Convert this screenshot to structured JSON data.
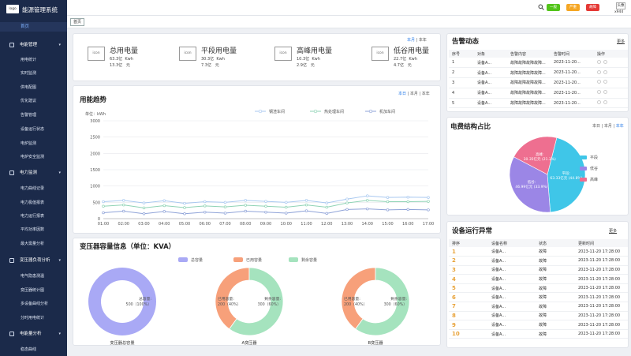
{
  "app": {
    "logo": "logo",
    "name": "能源管理系统"
  },
  "sidebar": {
    "home": "首页",
    "groups": [
      {
        "label": "电能管理",
        "items": [
          "用电统计",
          "实时监测",
          "供电配图",
          "优化建议",
          "告警管理",
          "设备运行状态",
          "电炉监测",
          "电炉安全监测"
        ]
      },
      {
        "label": "电力监测",
        "items": [
          "电力曲线记录",
          "电力极值报表",
          "电力运行报表",
          "平均功率因数",
          "最大需量分析"
        ]
      },
      {
        "label": "变压器负荷分析",
        "items": [
          "电气隐患测温",
          "变压器统计图",
          "多设备曲线分析",
          "分时用电统计"
        ]
      },
      {
        "label": "电能量分析",
        "items": [
          "稳态曲线"
        ]
      }
    ]
  },
  "topbar": {
    "buttons": [
      {
        "label": "一般",
        "color": "#52c41a"
      },
      {
        "label": "严重",
        "color": "#f5a623"
      },
      {
        "label": "故障",
        "color": "#e53935"
      }
    ],
    "avatar": "头像",
    "user": "x944"
  },
  "tabs": [
    "首页"
  ],
  "summary": {
    "period": {
      "a": "本月",
      "b": "本年"
    },
    "stats": [
      {
        "icon": "icon",
        "name": "总用电量",
        "v1": "63.3亿",
        "u1": "Kwh",
        "v2": "13.3亿",
        "u2": "元"
      },
      {
        "icon": "icon",
        "name": "平段用电量",
        "v1": "30.3亿",
        "u1": "Kwh",
        "v2": "7.3亿",
        "u2": "元"
      },
      {
        "icon": "icon",
        "name": "高峰用电量",
        "v1": "10.3亿",
        "u1": "Kwh",
        "v2": "2.9亿",
        "u2": "元"
      },
      {
        "icon": "icon",
        "name": "低谷用电量",
        "v1": "22.7亿",
        "u1": "Kwh",
        "v2": "4.7亿",
        "u2": "元"
      }
    ]
  },
  "trend": {
    "title": "用能趋势",
    "period": {
      "a": "本日",
      "b": "本月",
      "c": "本年"
    },
    "unit": "单位：kWh"
  },
  "alarms": {
    "title": "告警动态",
    "more": "更多",
    "columns": [
      "序号",
      "对象",
      "告警内容",
      "告警时间",
      "操作"
    ],
    "rows": [
      {
        "no": "1",
        "obj": "设备A...",
        "content": "故障故障故障故障...",
        "time": "2023-11-20..."
      },
      {
        "no": "2",
        "obj": "设备A...",
        "content": "故障故障故障故障...",
        "time": "2023-11-20..."
      },
      {
        "no": "3",
        "obj": "设备A...",
        "content": "故障故障故障故障...",
        "time": "2023-11-20..."
      },
      {
        "no": "4",
        "obj": "设备A...",
        "content": "故障故障故障故障...",
        "time": "2023-11-20..."
      },
      {
        "no": "5",
        "obj": "设备A...",
        "content": "故障故障故障故障...",
        "time": "2023-11-20..."
      }
    ]
  },
  "fee": {
    "title": "电费结构占比",
    "period": {
      "a": "本日",
      "b": "本月",
      "c": "本年"
    },
    "legend": [
      "平段",
      "低谷",
      "高峰"
    ],
    "slice_labels": [
      {
        "name": "平段:",
        "val": "63.33亿元 (44.8%)"
      },
      {
        "name": "低谷:",
        "val": "46.99亿元 (33.9%)"
      },
      {
        "name": "高峰:",
        "val": "30.35亿元 (21.3%)"
      }
    ]
  },
  "devices": {
    "title": "设备运行异常",
    "more": "更多",
    "columns": [
      "排序",
      "设备名称",
      "状态",
      "更新时间"
    ],
    "rows": [
      {
        "rank": "1",
        "name": "设备A...",
        "status": "故障",
        "time": "2023-11-20 17:28:00"
      },
      {
        "rank": "2",
        "name": "设备A...",
        "status": "故障",
        "time": "2023-11-20 17:28:00"
      },
      {
        "rank": "3",
        "name": "设备A...",
        "status": "故障",
        "time": "2023-11-20 17:28:00"
      },
      {
        "rank": "4",
        "name": "设备A...",
        "status": "故障",
        "time": "2023-11-20 17:28:00"
      },
      {
        "rank": "5",
        "name": "设备A...",
        "status": "故障",
        "time": "2023-11-20 17:28:00"
      },
      {
        "rank": "6",
        "name": "设备A...",
        "status": "故障",
        "time": "2023-11-20 17:28:00"
      },
      {
        "rank": "7",
        "name": "设备A...",
        "status": "故障",
        "time": "2023-11-20 17:28:00"
      },
      {
        "rank": "8",
        "name": "设备A...",
        "status": "故障",
        "time": "2023-11-20 17:28:00"
      },
      {
        "rank": "9",
        "name": "设备A...",
        "status": "故障",
        "time": "2023-11-20 17:28:00"
      },
      {
        "rank": "10",
        "name": "设备A...",
        "status": "故障",
        "time": "2023-11-20 17:28:00"
      }
    ]
  },
  "transformer": {
    "title": "变压器容量信息（单位：KVA）",
    "legend": [
      "总容量",
      "已用容量",
      "剩余容量"
    ]
  },
  "chart_data": [
    {
      "type": "line",
      "title": "用能趋势",
      "ylabel": "单位：kWh",
      "ylim": [
        0,
        3000
      ],
      "yticks": [
        "3000",
        "2500",
        "2000",
        "1500",
        "1000",
        "500",
        "0"
      ],
      "x": [
        "01:00",
        "02:00",
        "03:00",
        "04:00",
        "05:00",
        "06:00",
        "07:00",
        "08:00",
        "09:00",
        "10:00",
        "11:00",
        "12:00",
        "13:00",
        "14:00",
        "15:00",
        "16:00",
        "17:00"
      ],
      "series": [
        {
          "name": "钢渣车间",
          "color": "#a8c8f0",
          "values": [
            520,
            560,
            480,
            550,
            470,
            520,
            500,
            560,
            530,
            500,
            560,
            480,
            600,
            700,
            650,
            660,
            650
          ]
        },
        {
          "name": "热处理车间",
          "color": "#8fd3b5",
          "values": [
            380,
            420,
            330,
            400,
            340,
            390,
            360,
            410,
            380,
            350,
            420,
            350,
            480,
            560,
            520,
            520,
            530
          ]
        },
        {
          "name": "机加车间",
          "color": "#8fa3d8",
          "values": [
            180,
            230,
            150,
            220,
            150,
            200,
            170,
            230,
            200,
            170,
            240,
            160,
            280,
            300,
            270,
            280,
            270
          ]
        }
      ],
      "legend_position": "top",
      "grid": true
    },
    {
      "type": "pie",
      "title": "电费结构占比",
      "series": [
        {
          "name": "平段",
          "value": 63.33,
          "percent": 44.8,
          "color": "#3fc6e8"
        },
        {
          "name": "低谷",
          "value": 46.99,
          "percent": 33.9,
          "color": "#9b86e6"
        },
        {
          "name": "高峰",
          "value": 30.35,
          "percent": 21.3,
          "color": "#ee6f90"
        }
      ]
    },
    {
      "type": "pie",
      "title": "变压器总容量",
      "series": [
        {
          "name": "总容量:",
          "value": 500,
          "label": "500（100%）",
          "color": "#a9a9f5"
        }
      ]
    },
    {
      "type": "pie",
      "title": "A变压器",
      "series": [
        {
          "name": "已用容量:",
          "value": 200,
          "label": "200（40%）",
          "color": "#f7a07a"
        },
        {
          "name": "剩余容量:",
          "value": 300,
          "label": "300（60%）",
          "color": "#a5e3be"
        }
      ]
    },
    {
      "type": "pie",
      "title": "B变压器",
      "series": [
        {
          "name": "已用容量:",
          "value": 200,
          "label": "200（40%）",
          "color": "#f7a07a"
        },
        {
          "name": "剩余容量:",
          "value": 300,
          "label": "300（60%）",
          "color": "#a5e3be"
        }
      ]
    }
  ]
}
